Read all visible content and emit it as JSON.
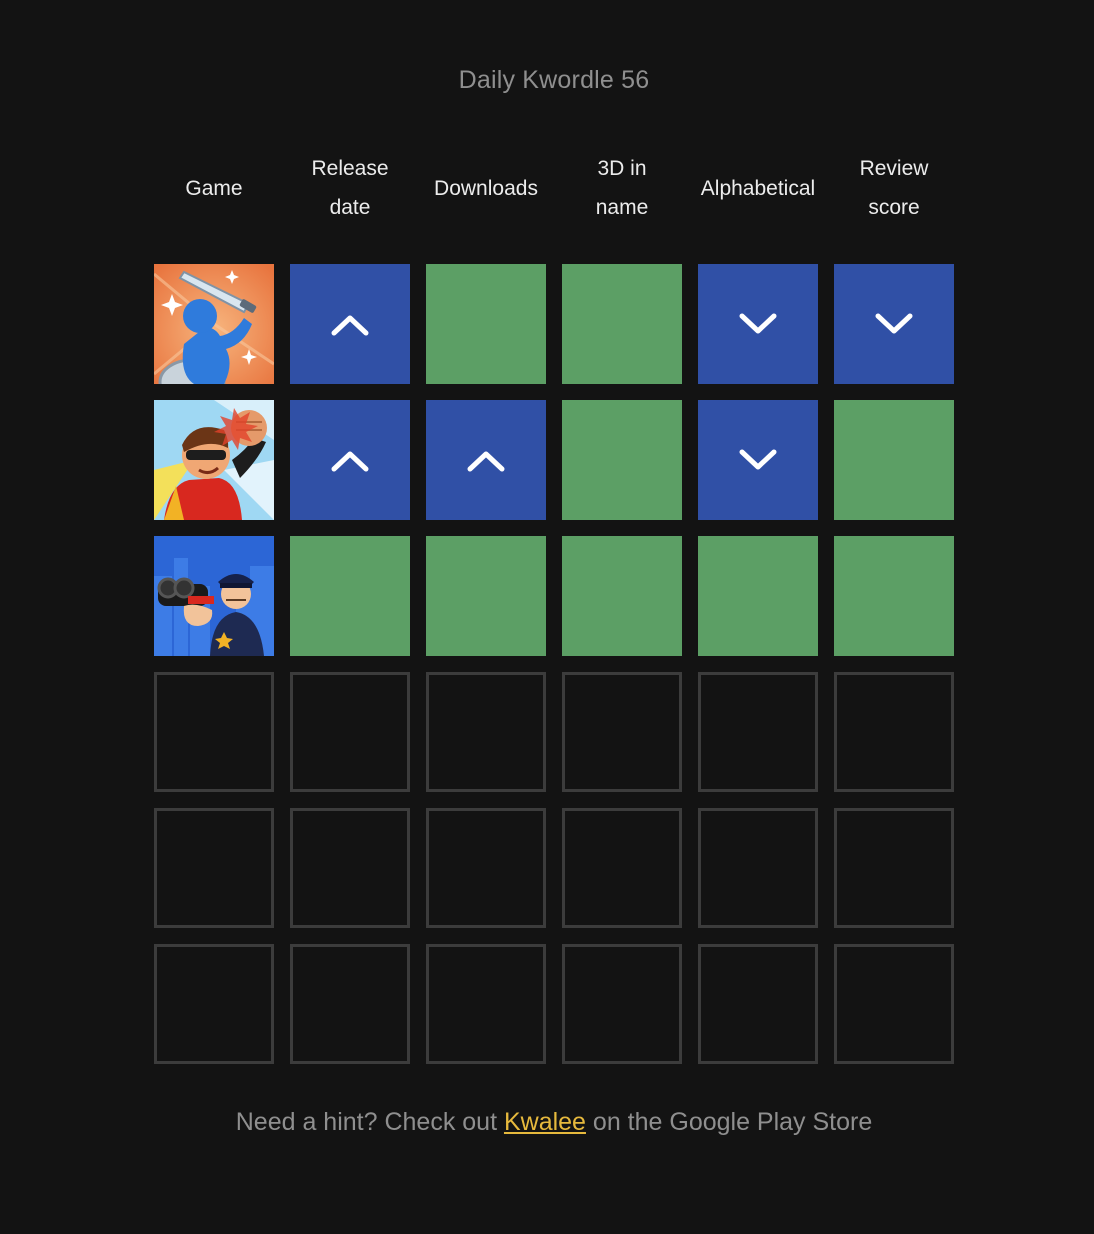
{
  "title": "Daily Kwordle 56",
  "columns": [
    {
      "line1": "Game",
      "line2": ""
    },
    {
      "line1": "Release",
      "line2": "date"
    },
    {
      "line1": "Downloads",
      "line2": ""
    },
    {
      "line1": "3D in",
      "line2": "name"
    },
    {
      "line1": "Alphabetical",
      "line2": ""
    },
    {
      "line1": "Review",
      "line2": "score"
    }
  ],
  "colors": {
    "correct": "#5c9f65",
    "hint": "#3050a6",
    "empty_border": "#3c3c3c",
    "link": "#e6b93d"
  },
  "guesses": [
    {
      "game_icon": "sword-hero-game-icon",
      "results": [
        "up",
        "correct",
        "correct",
        "down",
        "down"
      ]
    },
    {
      "game_icon": "superhero-punch-game-icon",
      "results": [
        "up",
        "up",
        "correct",
        "down",
        "correct"
      ]
    },
    {
      "game_icon": "police-officer-game-icon",
      "results": [
        "correct",
        "correct",
        "correct",
        "correct",
        "correct"
      ]
    }
  ],
  "empty_rows": 3,
  "footer": {
    "prefix": "Need a hint? Check out ",
    "link_text": "Kwalee",
    "suffix": " on the Google Play Store"
  }
}
